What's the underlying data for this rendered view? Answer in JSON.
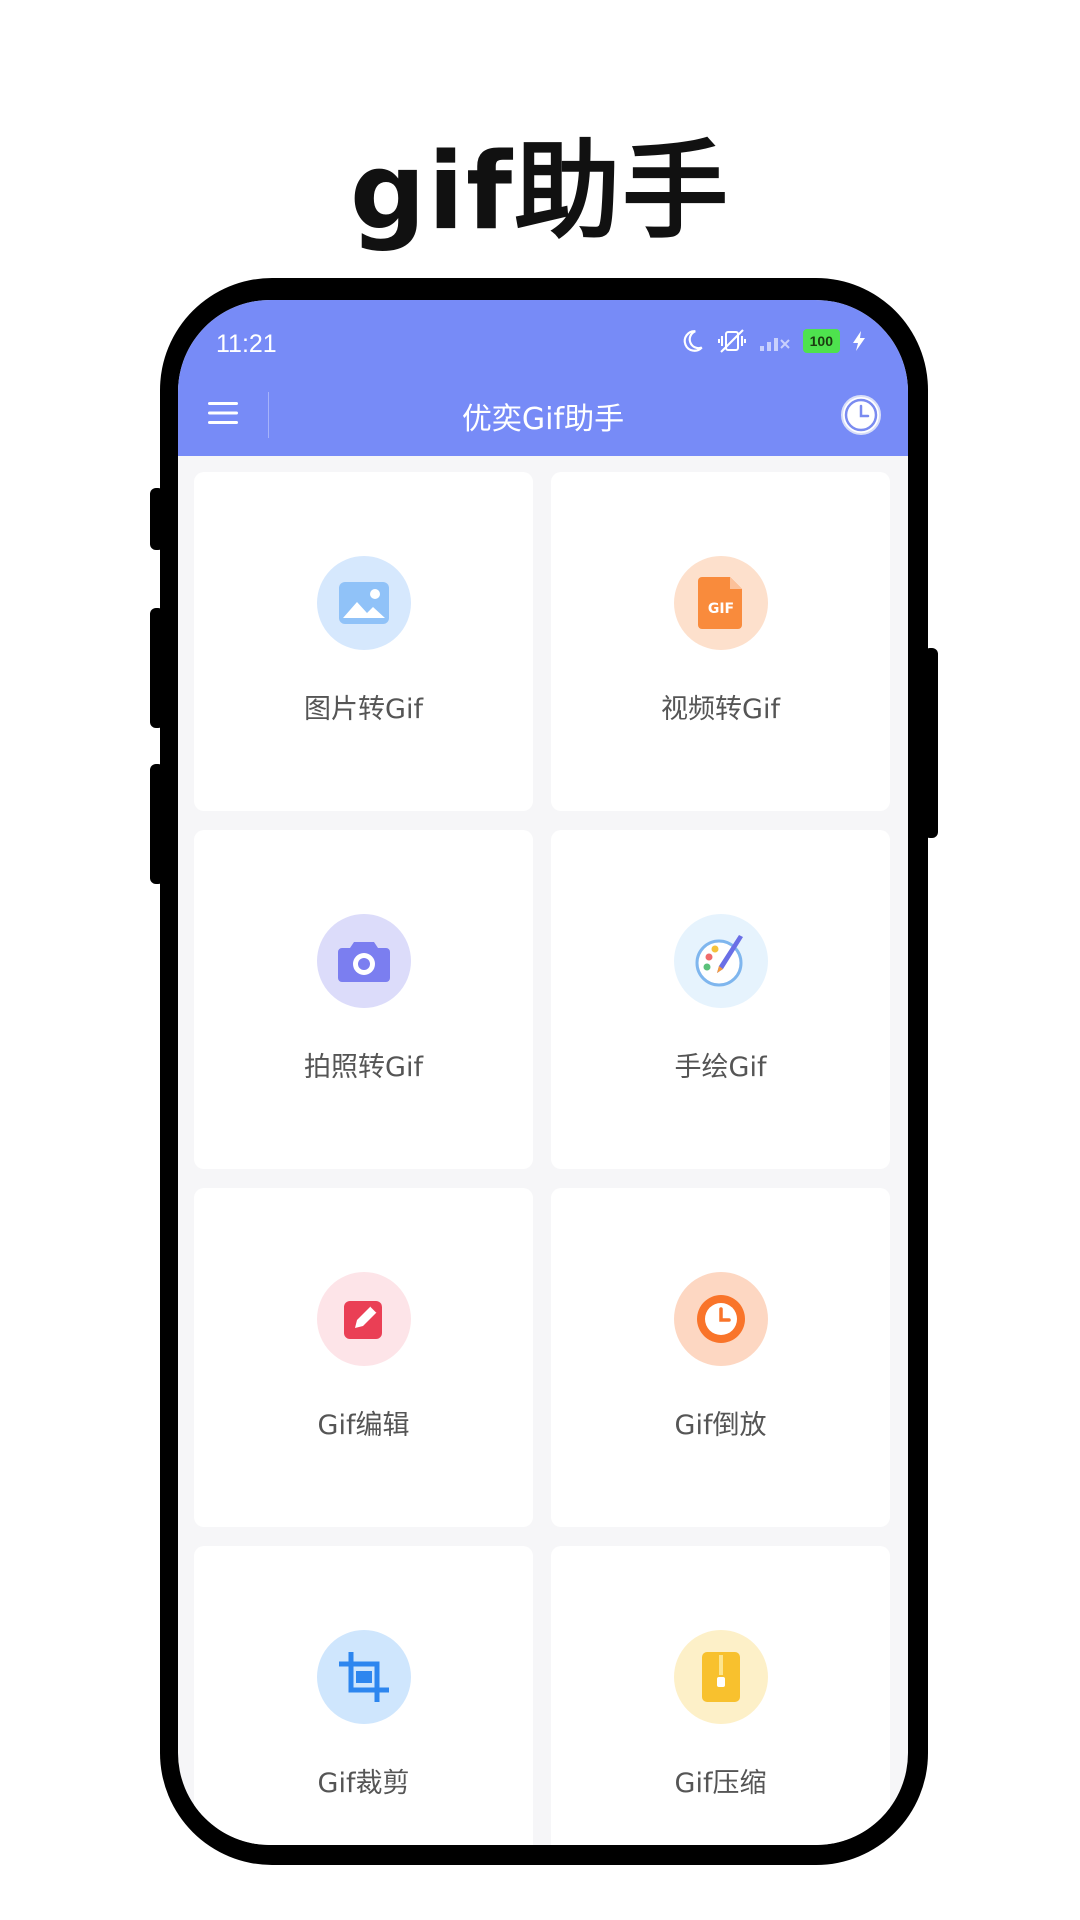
{
  "promo": {
    "title": "gif助手"
  },
  "status_bar": {
    "time": "11:21",
    "battery": "100"
  },
  "app_bar": {
    "title": "优奕Gif助手",
    "menu_icon": "menu-icon",
    "history_icon": "clock-icon"
  },
  "colors": {
    "accent": "#778bf7",
    "background": "#f6f6f8",
    "card": "#ffffff"
  },
  "tools": [
    {
      "label": "图片转Gif",
      "icon": "image-icon",
      "icon_bg": "#d6e8fd"
    },
    {
      "label": "视频转Gif",
      "icon": "gif-file-icon",
      "icon_bg": "#fde0cc"
    },
    {
      "label": "拍照转Gif",
      "icon": "camera-icon",
      "icon_bg": "#dcdcfa"
    },
    {
      "label": "手绘Gif",
      "icon": "paint-palette-icon",
      "icon_bg": "#e6f3fd"
    },
    {
      "label": "Gif编辑",
      "icon": "edit-icon",
      "icon_bg": "#fde4e8"
    },
    {
      "label": "Gif倒放",
      "icon": "clock-icon",
      "icon_bg": "#fdd7c2"
    },
    {
      "label": "Gif裁剪",
      "icon": "crop-icon",
      "icon_bg": "#cfe6fd"
    },
    {
      "label": "Gif压缩",
      "icon": "zip-icon",
      "icon_bg": "#fdf0c8"
    }
  ]
}
